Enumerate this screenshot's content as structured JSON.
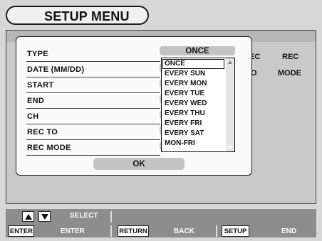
{
  "title": "SETUP MENU",
  "background_columns": {
    "col1_header_partial": "EC",
    "col1_sub_partial": "O",
    "col2_header": "REC",
    "col2_sub": "MODE"
  },
  "dialog": {
    "fields": [
      {
        "label": "TYPE",
        "value": "ONCE"
      },
      {
        "label": "DATE (MM/DD)",
        "value": ""
      },
      {
        "label": "START",
        "value": ""
      },
      {
        "label": "END",
        "value": ""
      },
      {
        "label": "CH",
        "value": ""
      },
      {
        "label": "REC TO",
        "value": ""
      },
      {
        "label": "REC MODE",
        "value": ""
      }
    ],
    "ok_label": "OK",
    "dropdown": {
      "selected": "ONCE",
      "options": [
        "ONCE",
        "EVERY SUN",
        "EVERY MON",
        "EVERY TUE",
        "EVERY WED",
        "EVERY THU",
        "EVERY FRI",
        "EVERY SAT",
        "MON-FRI"
      ]
    }
  },
  "footer": {
    "select_label": "SELECT",
    "keys": [
      {
        "key": "ENTER",
        "action": "ENTER"
      },
      {
        "key": "RETURN",
        "action": "BACK"
      },
      {
        "key": "SETUP",
        "action": "END"
      }
    ]
  },
  "icons": {
    "up": "triangle-up-icon",
    "down": "triangle-down-icon"
  }
}
